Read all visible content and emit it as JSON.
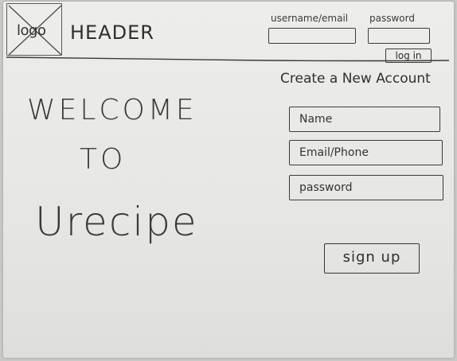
{
  "header": {
    "logo_text": "logo",
    "title": "HEADER",
    "login": {
      "username_label": "username/email",
      "password_label": "password",
      "username_value": "",
      "password_value": "",
      "button_label": "log in"
    }
  },
  "welcome": {
    "line1": "WELCOME",
    "line2": "TO",
    "line3": "Urecipe"
  },
  "signup_form": {
    "title": "Create a New Account",
    "name_placeholder": "Name",
    "email_placeholder": "Email/Phone",
    "password_placeholder": "password",
    "submit_label": "sign up"
  }
}
